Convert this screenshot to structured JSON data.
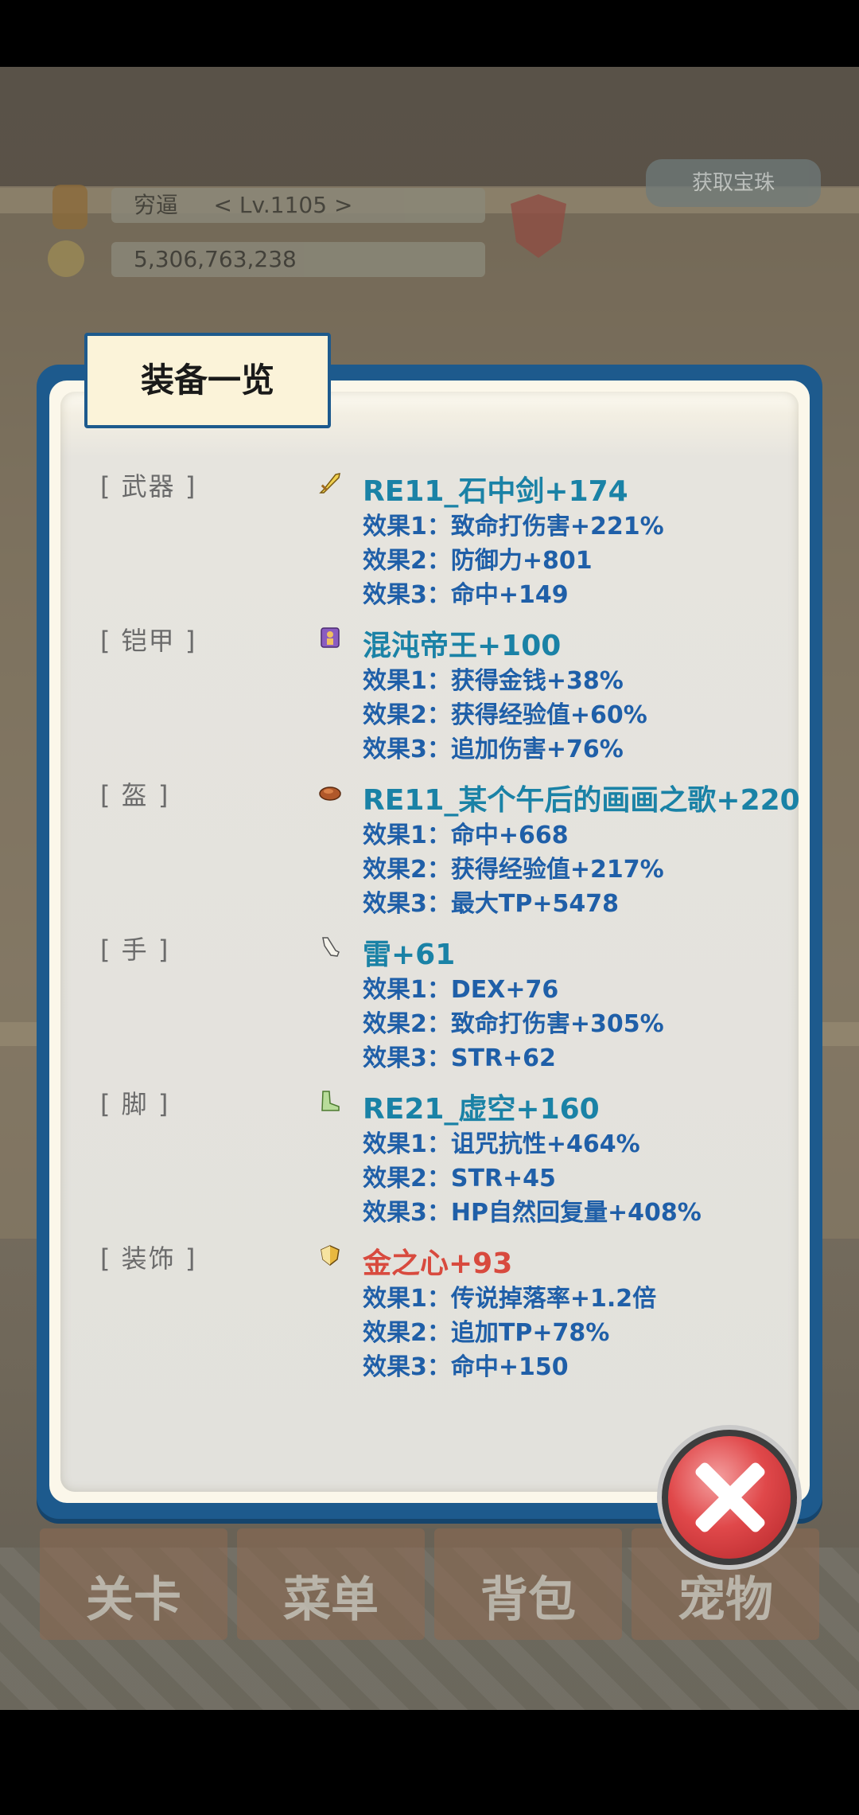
{
  "hud": {
    "player_name": "穷逼",
    "level": "< Lv.1105 >",
    "money": "5,306,763,238",
    "gem_button": "获取宝珠"
  },
  "tabs": [
    "关卡",
    "菜单",
    "背包",
    "宠物"
  ],
  "dialog": {
    "title": "装备一览",
    "slots": [
      {
        "label": "[ 武器 ]",
        "icon": "sword-icon",
        "name": "RE11_石中剑+174",
        "effects": [
          "效果1：致命打伤害+221%",
          "效果2：防御力+801",
          "效果3：命中+149"
        ]
      },
      {
        "label": "[ 铠甲 ]",
        "icon": "armor-icon",
        "name": "混沌帝王+100",
        "effects": [
          "效果1：获得金钱+38%",
          "效果2：获得经验值+60%",
          "效果3：追加伤害+76%"
        ]
      },
      {
        "label": "[ 盔 ]",
        "icon": "helmet-icon",
        "name": "RE11_某个午后的画画之歌+220",
        "effects": [
          "效果1：命中+668",
          "效果2：获得经验值+217%",
          "效果3：最大TP+5478"
        ]
      },
      {
        "label": "[ 手 ]",
        "icon": "glove-icon",
        "name": "雷+61",
        "effects": [
          "效果1：DEX+76",
          "效果2：致命打伤害+305%",
          "效果3：STR+62"
        ]
      },
      {
        "label": "[ 脚 ]",
        "icon": "boots-icon",
        "name": "RE21_虚空+160",
        "effects": [
          "效果1：诅咒抗性+464%",
          "效果2：STR+45",
          "效果3：HP自然回复量+408%"
        ]
      },
      {
        "label": "[ 装饰 ]",
        "icon": "shield-accessory-icon",
        "name": "金之心+93",
        "effects": [
          "效果1：传说掉落率+1.2倍",
          "效果2：追加TP+78%",
          "效果3：命中+150"
        ]
      }
    ]
  },
  "colors": {
    "item_name": "#1a82a6",
    "item_name_special": "#d84a3e",
    "effect_text": "#1f5fa8",
    "dialog_border": "#1d5a8d"
  }
}
